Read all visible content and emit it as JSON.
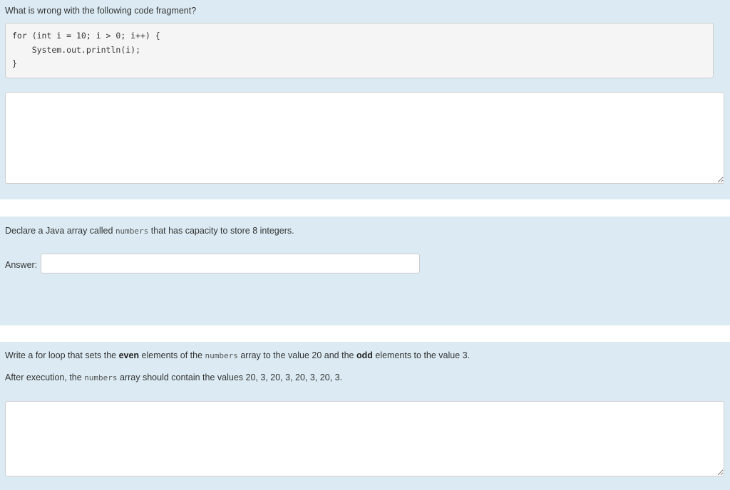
{
  "q1": {
    "prompt": "What is wrong with the following code fragment?",
    "code_line1": "for (int i = 10; i > 0; i++) {",
    "code_line2": "    System.out.println(i);",
    "code_line3": "}",
    "answer_value": ""
  },
  "q2": {
    "prompt_before": "Declare a Java array called ",
    "prompt_code": "numbers",
    "prompt_after": " that has capacity to store 8 integers.",
    "answer_label": "Answer:",
    "answer_value": ""
  },
  "q3": {
    "line1_part1": "Write a for loop that sets the ",
    "line1_bold1": "even",
    "line1_part2": " elements of the ",
    "line1_code": "numbers",
    "line1_part3": " array to the value 20 and the ",
    "line1_bold2": "odd",
    "line1_part4": " elements to the value 3.",
    "line2_part1": "After execution, the ",
    "line2_code": "numbers",
    "line2_part2": " array should contain the values 20, 3, 20, 3, 20, 3, 20, 3.",
    "answer_value": ""
  }
}
